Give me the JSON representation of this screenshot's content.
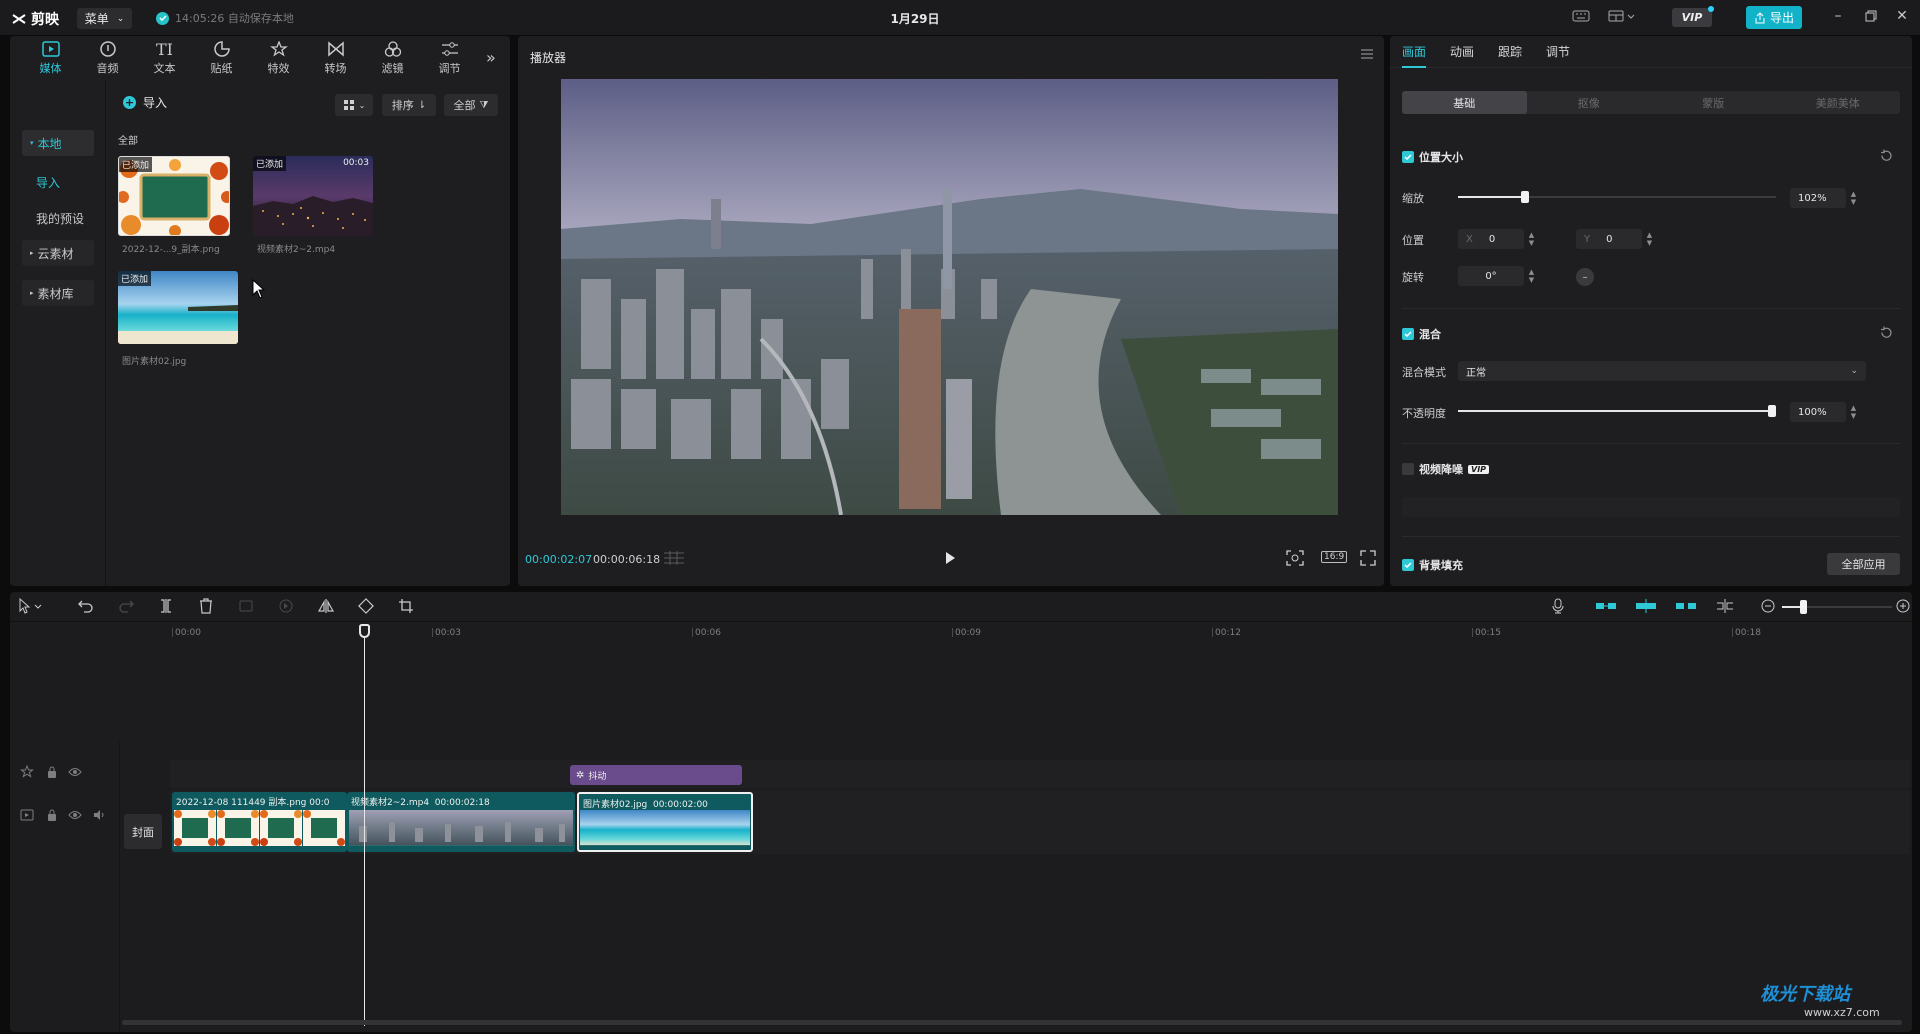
{
  "app": {
    "name": "剪映",
    "menu_label": "菜单",
    "autosave": "14:05:26 自动保存本地",
    "project_title": "1月29日",
    "vip": "VIP",
    "export": "导出"
  },
  "media": {
    "tabs": [
      {
        "label": "媒体",
        "icon": "media-icon"
      },
      {
        "label": "音频",
        "icon": "audio-icon"
      },
      {
        "label": "文本",
        "icon": "text-icon"
      },
      {
        "label": "贴纸",
        "icon": "sticker-icon"
      },
      {
        "label": "特效",
        "icon": "effects-icon"
      },
      {
        "label": "转场",
        "icon": "transition-icon"
      },
      {
        "label": "滤镜",
        "icon": "filter-icon"
      },
      {
        "label": "调节",
        "icon": "adjust-icon"
      }
    ],
    "sidebar": {
      "local": "本地",
      "import": "导入",
      "presets": "我的预设",
      "cloud": "云素材",
      "library": "素材库"
    },
    "import_label": "导入",
    "sort_label": "排序",
    "filter_label": "全部",
    "section_all": "全部",
    "items": [
      {
        "badge": "已添加",
        "caption": "2022-12-...9_副本.png",
        "duration": ""
      },
      {
        "badge": "已添加",
        "caption": "视频素材2~2.mp4",
        "duration": "00:03"
      },
      {
        "badge": "已添加",
        "caption": "图片素材02.jpg",
        "duration": ""
      }
    ]
  },
  "player": {
    "title": "播放器",
    "current_time": "00:00:02:07",
    "total_time": "00:00:06:18",
    "ratio": "16:9"
  },
  "props": {
    "tabs": [
      "画面",
      "动画",
      "跟踪",
      "调节"
    ],
    "sub_tabs": [
      "基础",
      "抠像",
      "蒙版",
      "美颜美体"
    ],
    "position_size": "位置大小",
    "scale_label": "缩放",
    "scale_value": "102%",
    "scale_fraction": 0.21,
    "position_label": "位置",
    "pos_x_label": "X",
    "pos_x": "0",
    "pos_y_label": "Y",
    "pos_y": "0",
    "rotation_label": "旋转",
    "rotation": "0°",
    "blend_title": "混合",
    "blend_mode_label": "混合模式",
    "blend_mode": "正常",
    "opacity_label": "不透明度",
    "opacity_value": "100%",
    "opacity_fraction": 1.0,
    "denoise_label": "视频降噪",
    "denoise_badge": "VIP",
    "bg_fill_label": "背景填充",
    "apply_all": "全部应用"
  },
  "timeline": {
    "ruler": [
      "00:00",
      "00:03",
      "00:06",
      "00:09",
      "00:12",
      "00:15",
      "00:18"
    ],
    "cover_label": "封面",
    "effect_clip": "抖动",
    "clips": [
      {
        "name": "2022-12-08 111449 副本.png",
        "duration": "00:0"
      },
      {
        "name": "视频素材2~2.mp4",
        "duration": "00:00:02:18"
      },
      {
        "name": "图片素材02.jpg",
        "duration": "00:00:02:00"
      }
    ]
  },
  "watermark": {
    "brand": "极光下载站",
    "url": "www.xz7.com"
  },
  "colors": {
    "accent": "#2ec8d6",
    "panel": "#1e1e20",
    "background": "#0c0c0d",
    "effect_clip": "#6a4c8c",
    "clip_teal": "#0e5a5e"
  }
}
